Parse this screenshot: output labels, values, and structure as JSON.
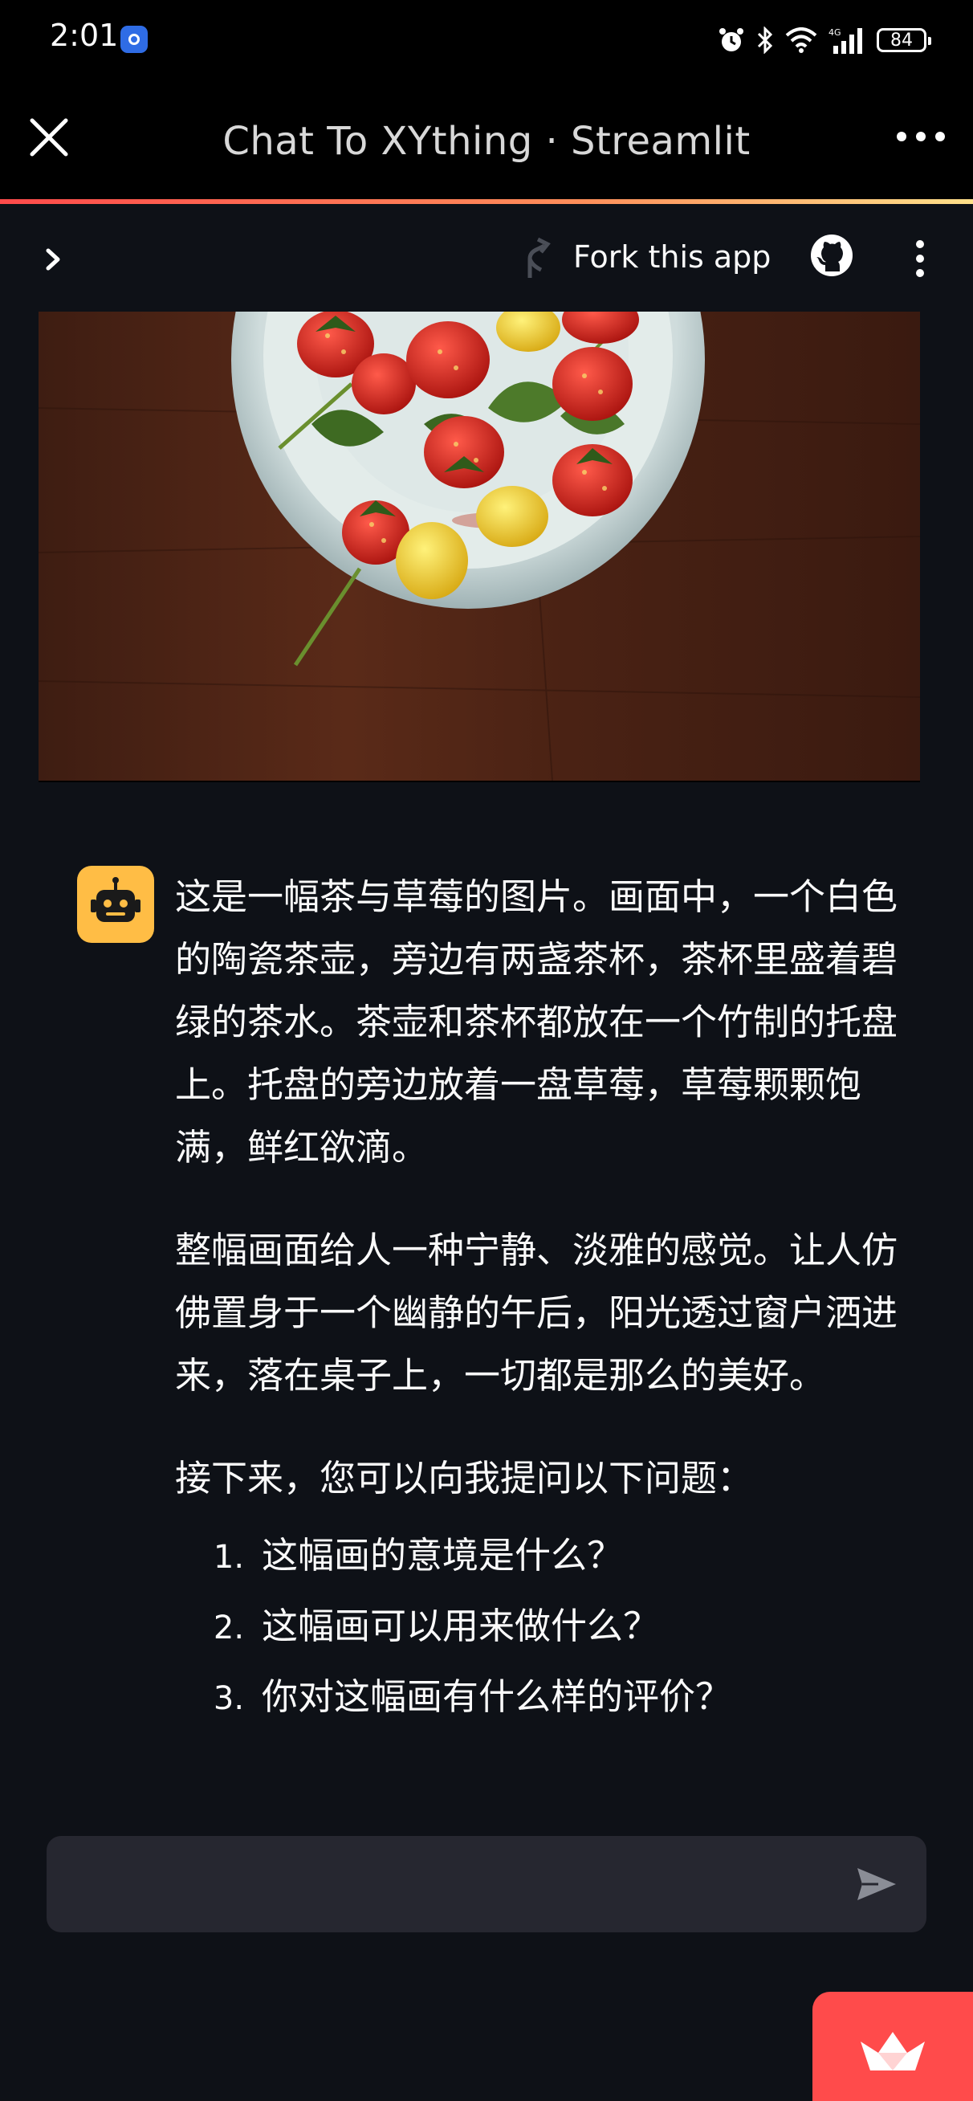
{
  "status_bar": {
    "time": "2:01",
    "battery": "84"
  },
  "app_bar": {
    "title": "Chat To XYthing · Streamlit"
  },
  "streamlit_header": {
    "fork_label": "Fork this app"
  },
  "message": {
    "paragraphs": [
      "这是一幅茶与草莓的图片。画面中，一个白色的陶瓷茶壶，旁边有两盏茶杯，茶杯里盛着碧绿的茶水。茶壶和茶杯都放在一个竹制的托盘上。托盘的旁边放着一盘草莓，草莓颗颗饱满，鲜红欲滴。",
      "整幅画面给人一种宁静、淡雅的感觉。让人仿佛置身于一个幽静的午后，阳光透过窗户洒进来，落在桌子上，一切都是那么的美好。",
      "接下来，您可以向我提问以下问题："
    ],
    "questions": [
      {
        "num": "1.",
        "text": "这幅画的意境是什么？"
      },
      {
        "num": "2.",
        "text": "这幅画可以用来做什么？"
      },
      {
        "num": "3.",
        "text": "你对这幅画有什么样的评价？"
      }
    ]
  },
  "chat_input": {
    "value": "",
    "placeholder": ""
  },
  "colors": {
    "background": "#0e1117",
    "accent": "#ff4b4b",
    "avatar": "#ffbd45",
    "input_bg": "#262730"
  }
}
